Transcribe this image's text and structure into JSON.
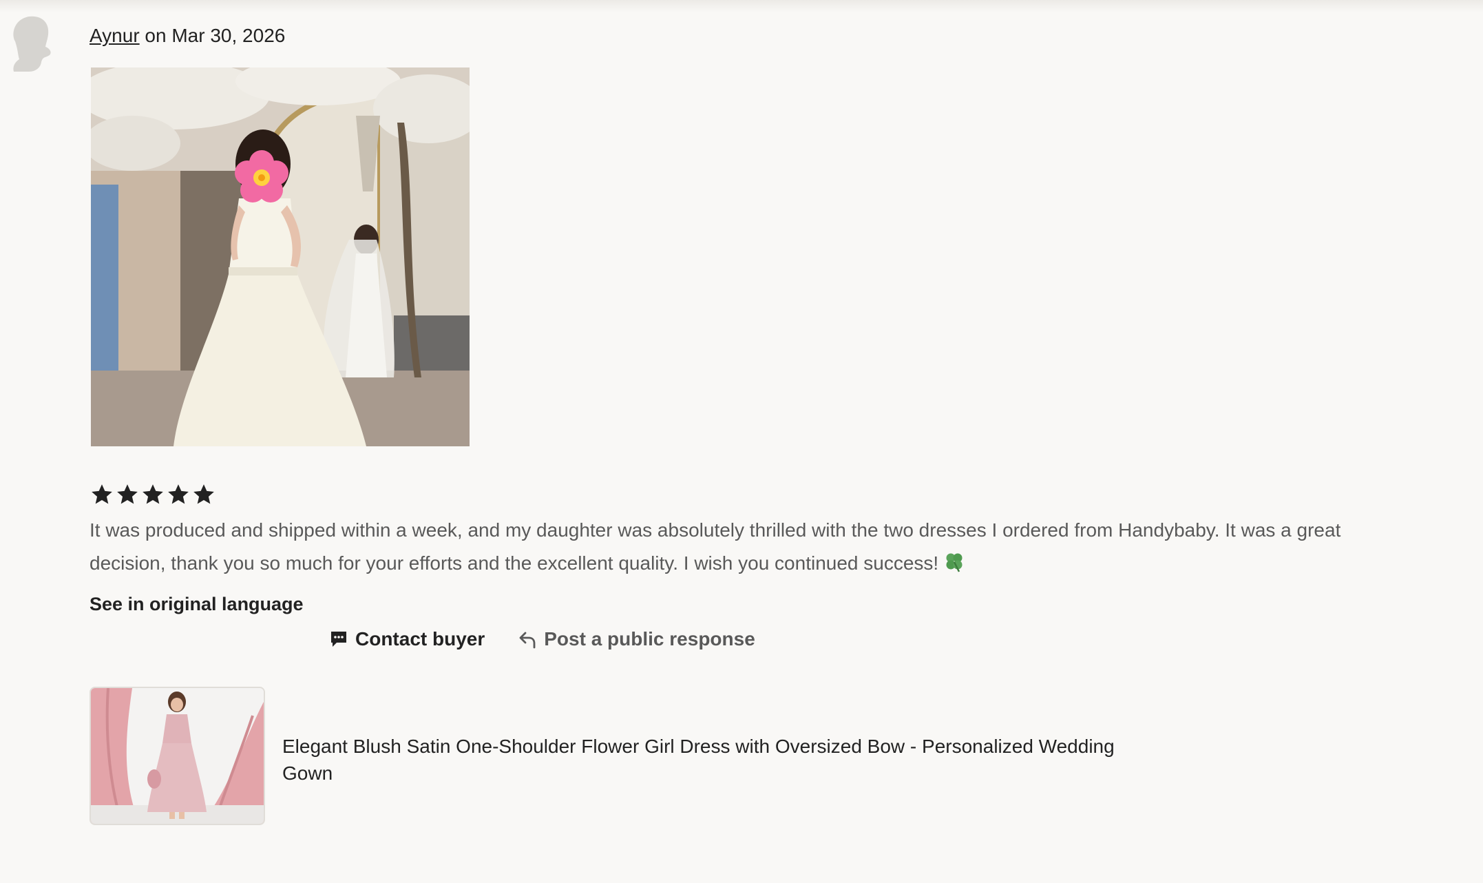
{
  "review": {
    "reviewer_name": "Aynur",
    "date_text": "on Mar 30, 2026",
    "rating": 5,
    "rating_max": 5,
    "text": "It was produced and shipped within a week, and my daughter was absolutely thrilled with the two dresses I ordered from Handybaby. It was a great decision, thank you so much for your efforts and the excellent quality. I wish you continued success!",
    "original_language_link": "See in original language"
  },
  "actions": {
    "contact_buyer": "Contact buyer",
    "public_response": "Post a public response"
  },
  "product": {
    "title": "Elegant Blush Satin One-Shoulder Flower Girl Dress with Oversized Bow - Personalized Wedding Gown"
  },
  "icons": {
    "avatar": "default-avatar-icon",
    "star": "star-icon",
    "clover": "four-leaf-clover-icon",
    "contact": "chat-bubble-icon",
    "reply": "reply-arrow-icon"
  },
  "colors": {
    "background": "#f9f8f6",
    "text_primary": "#222222",
    "text_secondary": "#595959",
    "star": "#222222"
  }
}
